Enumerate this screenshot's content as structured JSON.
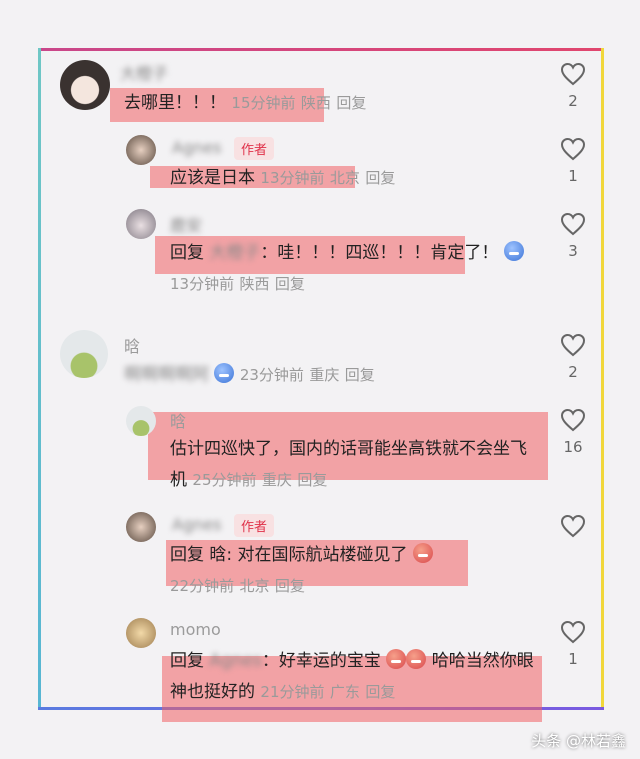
{
  "comments": [
    {
      "name": "大橙子",
      "text": "去哪里！！！",
      "time": "15分钟前",
      "location": "陕西",
      "reply": "回复",
      "likes": "2"
    },
    {
      "name": "Agnes",
      "badge": "作者",
      "text": "应该是日本",
      "time": "13分钟前",
      "location": "北京",
      "reply": "回复",
      "likes": "1"
    },
    {
      "name": "鹿安",
      "prefix": "回复",
      "mention": "大橙子",
      "text": "：哇！！！四巡！！！肯定了！",
      "time": "13分钟前",
      "location": "陕西",
      "reply": "回复",
      "likes": "3"
    },
    {
      "name": "晗",
      "text": "啊啊啊啊阿",
      "time": "23分钟前",
      "location": "重庆",
      "reply": "回复",
      "likes": "2"
    },
    {
      "name": "晗",
      "text": "估计四巡快了，国内的话哥能坐高铁就不会坐飞机",
      "time": "25分钟前",
      "location": "重庆",
      "reply": "回复",
      "likes": "16"
    },
    {
      "name": "Agnes",
      "badge": "作者",
      "prefix": "回复",
      "mention": "晗",
      "text": ": 对在国际航站楼碰见了",
      "time": "22分钟前",
      "location": "北京",
      "reply": "回复",
      "likes": ""
    },
    {
      "name": "momo",
      "prefix": "回复",
      "mention": "Agnes",
      "text_a": "：好幸运的宝宝",
      "text_b": "哈哈当然你眼神也挺好的",
      "time": "21分钟前",
      "location": "广东",
      "reply": "回复",
      "likes": "1"
    }
  ],
  "watermark": "头条 @林若鑫",
  "colors": {
    "highlight": "#f06064",
    "badge_bg": "#f8e1e2",
    "badge_text": "#e0324a",
    "frame_top": "#e0466e",
    "frame_left": "#6fc7c5",
    "frame_right": "#f1d73a",
    "frame_bottom": "#5a7be0"
  }
}
